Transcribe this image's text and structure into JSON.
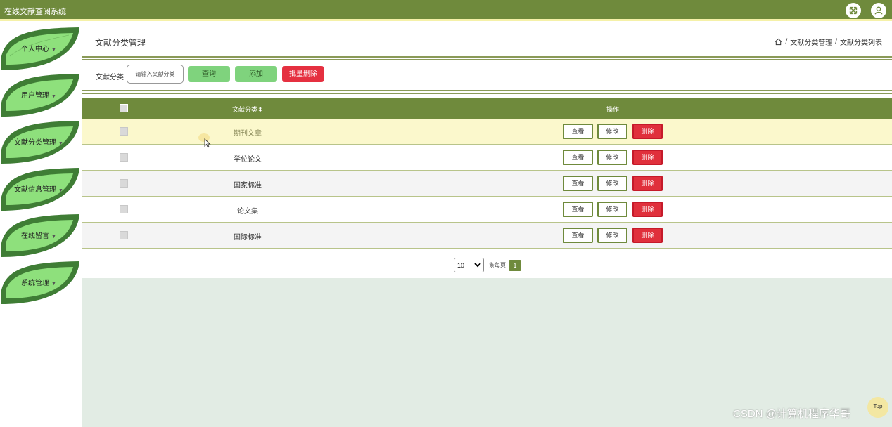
{
  "app": {
    "title": "在线文献查阅系统"
  },
  "topbar": {
    "icons": [
      "expand-icon",
      "user-icon"
    ]
  },
  "colors": {
    "brand": "#6f8a3c",
    "leaf_dark": "#3f7d35",
    "leaf_light": "#8ee07c",
    "accent_red": "#e0303c",
    "button_green": "#7fd37d"
  },
  "sidebar": {
    "items": [
      {
        "label": "个人中心"
      },
      {
        "label": "用户管理"
      },
      {
        "label": "文献分类管理"
      },
      {
        "label": "文献信息管理"
      },
      {
        "label": "在线留言"
      },
      {
        "label": "系统管理"
      }
    ]
  },
  "page": {
    "title": "文献分类管理",
    "breadcrumb": [
      "文献分类管理",
      "文献分类列表"
    ]
  },
  "search": {
    "label": "文献分类",
    "placeholder": "请输入文献分类",
    "query_label": "查询",
    "add_label": "添加",
    "batch_delete_label": "批量删除"
  },
  "table": {
    "columns": {
      "name": "文献分类",
      "actions": "操作"
    },
    "actions": {
      "view": "查看",
      "edit": "修改",
      "delete": "删除"
    },
    "rows": [
      {
        "name": "期刊文章",
        "highlighted": true
      },
      {
        "name": "学位论文",
        "highlighted": false
      },
      {
        "name": "国家标准",
        "highlighted": false
      },
      {
        "name": "论文集",
        "highlighted": false
      },
      {
        "name": "国际标准",
        "highlighted": false
      }
    ]
  },
  "pagination": {
    "page_size": "10",
    "per_page_label": "条每页",
    "current_page": "1"
  },
  "scroll_top": {
    "label": "Top"
  },
  "watermark": "CSDN @计算机程序华哥"
}
